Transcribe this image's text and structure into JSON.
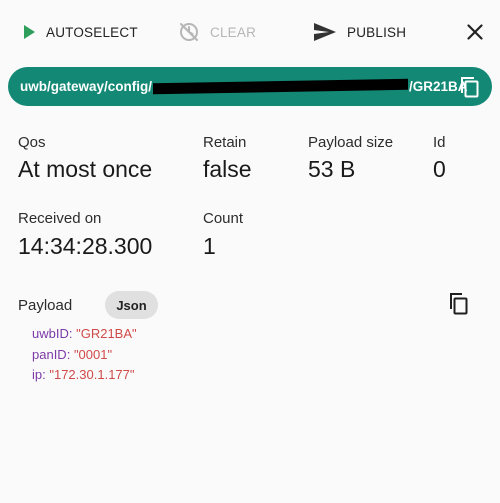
{
  "toolbar": {
    "autoselect_label": "AUTOSELECT",
    "clear_label": "CLEAR",
    "publish_label": "PUBLISH"
  },
  "topic": {
    "prefix": "uwb/gateway/config/",
    "suffix": "/GR21BA"
  },
  "details": {
    "qos_label": "Qos",
    "qos_value": "At most once",
    "retain_label": "Retain",
    "retain_value": "false",
    "payload_size_label": "Payload size",
    "payload_size_value": "53 B",
    "id_label": "Id",
    "id_value": "0",
    "received_label": "Received on",
    "received_value": "14:34:28.300",
    "count_label": "Count",
    "count_value": "1"
  },
  "payload": {
    "label": "Payload",
    "format_chip": "Json",
    "lines": [
      {
        "key": "uwbID",
        "value": "\"GR21BA\""
      },
      {
        "key": "panID",
        "value": "\"0001\""
      },
      {
        "key": "ip",
        "value": "\"172.30.1.177\""
      }
    ]
  },
  "colors": {
    "accent": "#138875",
    "play_icon": "#2e9e5b",
    "disabled": "#b6b6b6",
    "json_key": "#7c3aa8",
    "json_value": "#d14a4a"
  },
  "icons": {
    "autoselect": "play-icon",
    "clear": "clear-disabled-icon",
    "publish": "send-icon",
    "close": "close-icon",
    "copy": "copy-icon"
  }
}
